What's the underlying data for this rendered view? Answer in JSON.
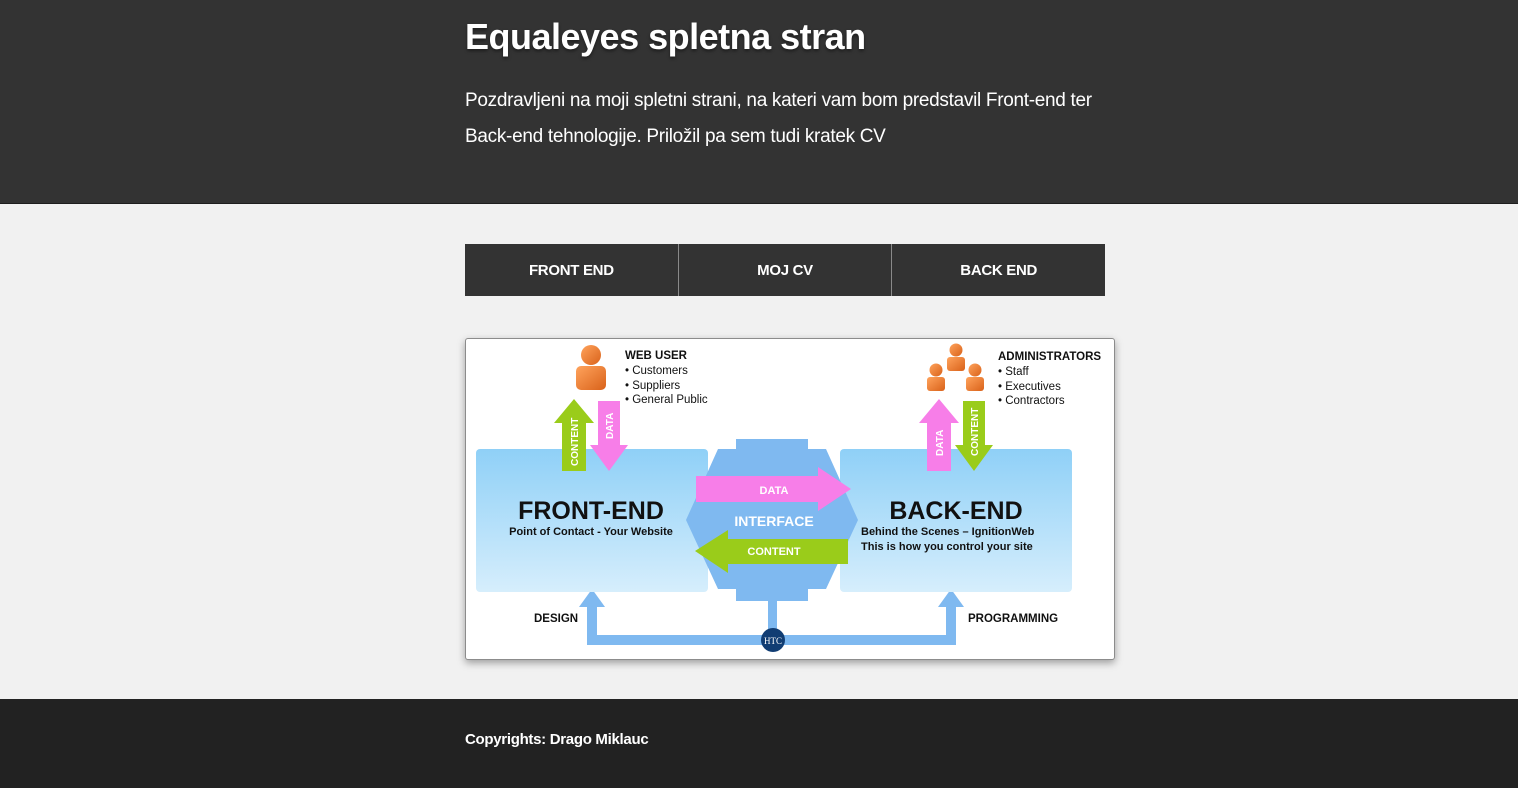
{
  "header": {
    "title": "Equaleyes spletna stran",
    "intro": "Pozdravljeni na moji spletni strani, na kateri vam bom predstavil Front-end ter Back-end tehnologije. Priložil pa sem tudi kratek CV"
  },
  "nav": {
    "items": [
      {
        "label": "FRONT END"
      },
      {
        "label": "MOJ CV"
      },
      {
        "label": "BACK END"
      }
    ]
  },
  "diagram": {
    "web_user_title": "WEB USER",
    "web_user_items": [
      "• Customers",
      "• Suppliers",
      "• General Public"
    ],
    "admin_title": "ADMINISTRATORS",
    "admin_items": [
      "• Staff",
      "• Executives",
      "• Contractors"
    ],
    "front_title": "FRONT-END",
    "front_sub": "Point of Contact - Your Website",
    "back_title": "BACK-END",
    "back_sub1": "Behind the Scenes – IgnitionWeb",
    "back_sub2": "This is how you control your site",
    "interface": "INTERFACE",
    "data_label": "DATA",
    "content_label": "CONTENT",
    "design": "DESIGN",
    "programming": "PROGRAMMING",
    "logo": "HTC",
    "colors": {
      "panel": "#9ed6f5",
      "arrow_blue": "#7fb9f0",
      "data_pink": "#f77ee8",
      "content_green": "#9acc1a",
      "person_orange": "#f07d2a",
      "logo_navy": "#113d73"
    }
  },
  "footer": {
    "copyright": "Copyrights: Drago Miklauc"
  }
}
